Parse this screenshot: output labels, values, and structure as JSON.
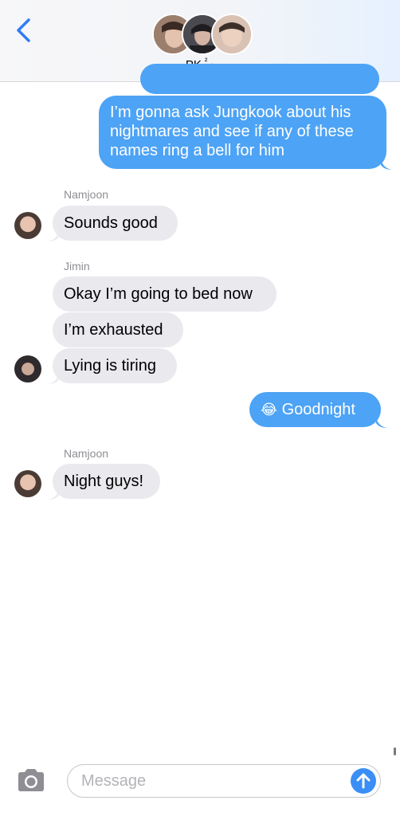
{
  "header": {
    "group_name": "PK",
    "group_count": "²",
    "chevron": "›",
    "back_icon": "chevron-left-icon"
  },
  "messages": {
    "m0_partial": "",
    "m1": {
      "line1": "I’m gonna ask Jungkook about his",
      "line2": "nightmares and see if any of these",
      "line3": "names ring a bell for him"
    },
    "sender_namjoon_1": "Namjoon",
    "m2": "Sounds good",
    "sender_jimin": "Jimin",
    "m3": "Okay I’m going to bed now",
    "m4": "I’m exhausted",
    "m5": "Lying is tiring",
    "m6": "Goodnight",
    "m6_emoji": "😂",
    "sender_namjoon_2": "Namjoon",
    "m7": "Night guys!"
  },
  "composer": {
    "placeholder": "Message",
    "camera_icon": "camera-icon",
    "send_icon": "arrow-up-icon"
  },
  "colors": {
    "outgoing": "#4da3f5",
    "incoming": "#e9e9ee",
    "accent": "#3a8ef6"
  }
}
